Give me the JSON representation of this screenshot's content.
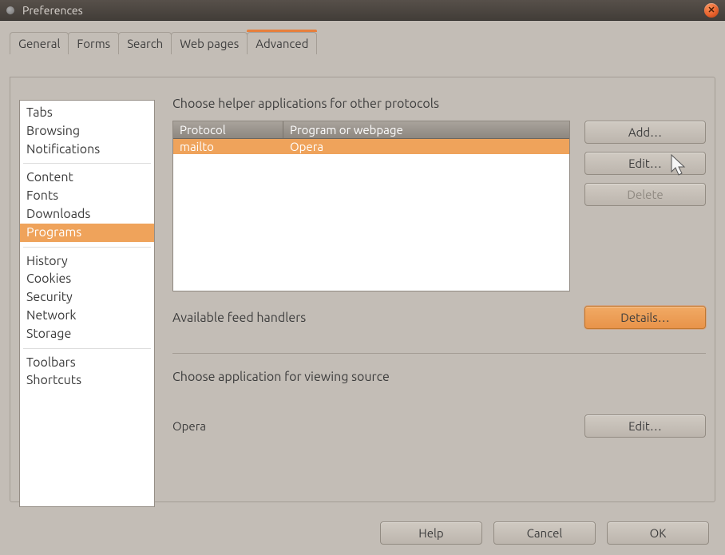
{
  "window": {
    "title": "Preferences"
  },
  "tabs": [
    {
      "label": "General"
    },
    {
      "label": "Forms"
    },
    {
      "label": "Search"
    },
    {
      "label": "Web pages"
    },
    {
      "label": "Advanced"
    }
  ],
  "active_tab": 4,
  "sidebar": {
    "groups": [
      [
        "Tabs",
        "Browsing",
        "Notifications"
      ],
      [
        "Content",
        "Fonts",
        "Downloads",
        "Programs"
      ],
      [
        "History",
        "Cookies",
        "Security",
        "Network",
        "Storage"
      ],
      [
        "Toolbars",
        "Shortcuts"
      ]
    ],
    "selected": "Programs"
  },
  "protocols": {
    "heading": "Choose helper applications for other protocols",
    "columns": {
      "protocol": "Protocol",
      "program": "Program or webpage"
    },
    "rows": [
      {
        "protocol": "mailto",
        "program": "Opera"
      }
    ],
    "buttons": {
      "add": "Add…",
      "edit": "Edit…",
      "delete": "Delete"
    }
  },
  "feeds": {
    "heading": "Available feed handlers",
    "details": "Details…"
  },
  "source": {
    "heading": "Choose application for viewing source",
    "current": "Opera",
    "edit": "Edit…"
  },
  "footer": {
    "help": "Help",
    "cancel": "Cancel",
    "ok": "OK"
  }
}
